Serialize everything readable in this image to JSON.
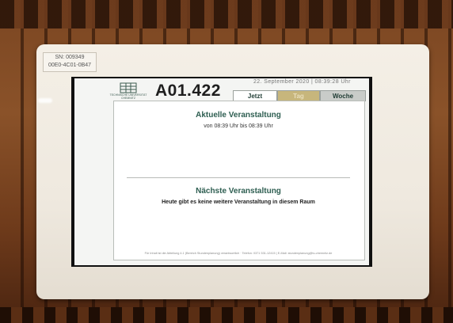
{
  "label": {
    "line1": "SN: 009349",
    "line2": "00E0-4C01-0B47"
  },
  "header": {
    "logo_text": "TECHNISCHE UNIVERSITÄT CHEMNITZ",
    "room": "A01.422",
    "datetime": "22. September 2020 | 08:39:28 Uhr"
  },
  "tabs": [
    {
      "label": "Jetzt",
      "active": true
    },
    {
      "label": "Tag",
      "active": false
    },
    {
      "label": "Woche",
      "active": false
    }
  ],
  "current": {
    "title": "Aktuelle Veranstaltung",
    "time": "von 08:39 Uhr bis 08:39 Uhr"
  },
  "next": {
    "title": "Nächste Veranstaltung",
    "text": "Heute gibt es keine weitere Veranstaltung in diesem Raum"
  },
  "footer": {
    "text": "Für Inhalt ist die Abteilung 4.1 (Bereich Stundenplanung) verantwortlich · Telefon: 0371 531-12415 | E-Mail: stundenplanung@tu-chemnitz.de"
  },
  "colors": {
    "accent": "#2e5e51",
    "wood": "#7b4622",
    "frame": "#f4efe6"
  }
}
